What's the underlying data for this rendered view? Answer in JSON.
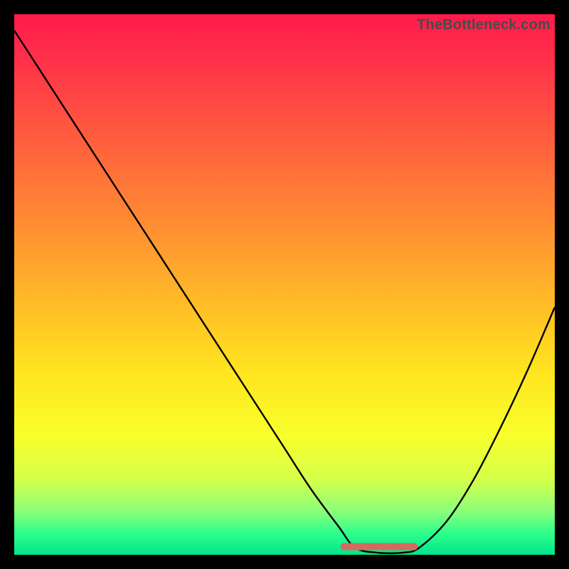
{
  "watermark": "TheBottleneck.com",
  "chart_data": {
    "type": "line",
    "title": "",
    "xlabel": "",
    "ylabel": "",
    "xlim": [
      0,
      100
    ],
    "ylim": [
      0,
      100
    ],
    "series": [
      {
        "name": "bottleneck-curve",
        "x": [
          0,
          5,
          10,
          15,
          20,
          25,
          30,
          35,
          40,
          45,
          50,
          55,
          60,
          63,
          67,
          72,
          75,
          80,
          85,
          90,
          95,
          100
        ],
        "values": [
          100,
          92,
          84,
          76,
          68,
          60,
          52,
          44,
          36,
          28,
          20,
          12,
          5,
          1,
          0,
          0,
          1,
          6,
          14,
          24,
          35,
          47
        ]
      }
    ],
    "annotation_segment": {
      "name": "optimal-zone",
      "x_start": 61,
      "x_end": 74,
      "color": "#d46a5e",
      "thickness_px": 10
    },
    "colors": {
      "gradient_top": "#ff1a4a",
      "gradient_mid": "#ffe41f",
      "gradient_bottom": "#00e58a",
      "curve": "#000000",
      "annotation": "#d46a5e",
      "background": "#000000"
    }
  }
}
